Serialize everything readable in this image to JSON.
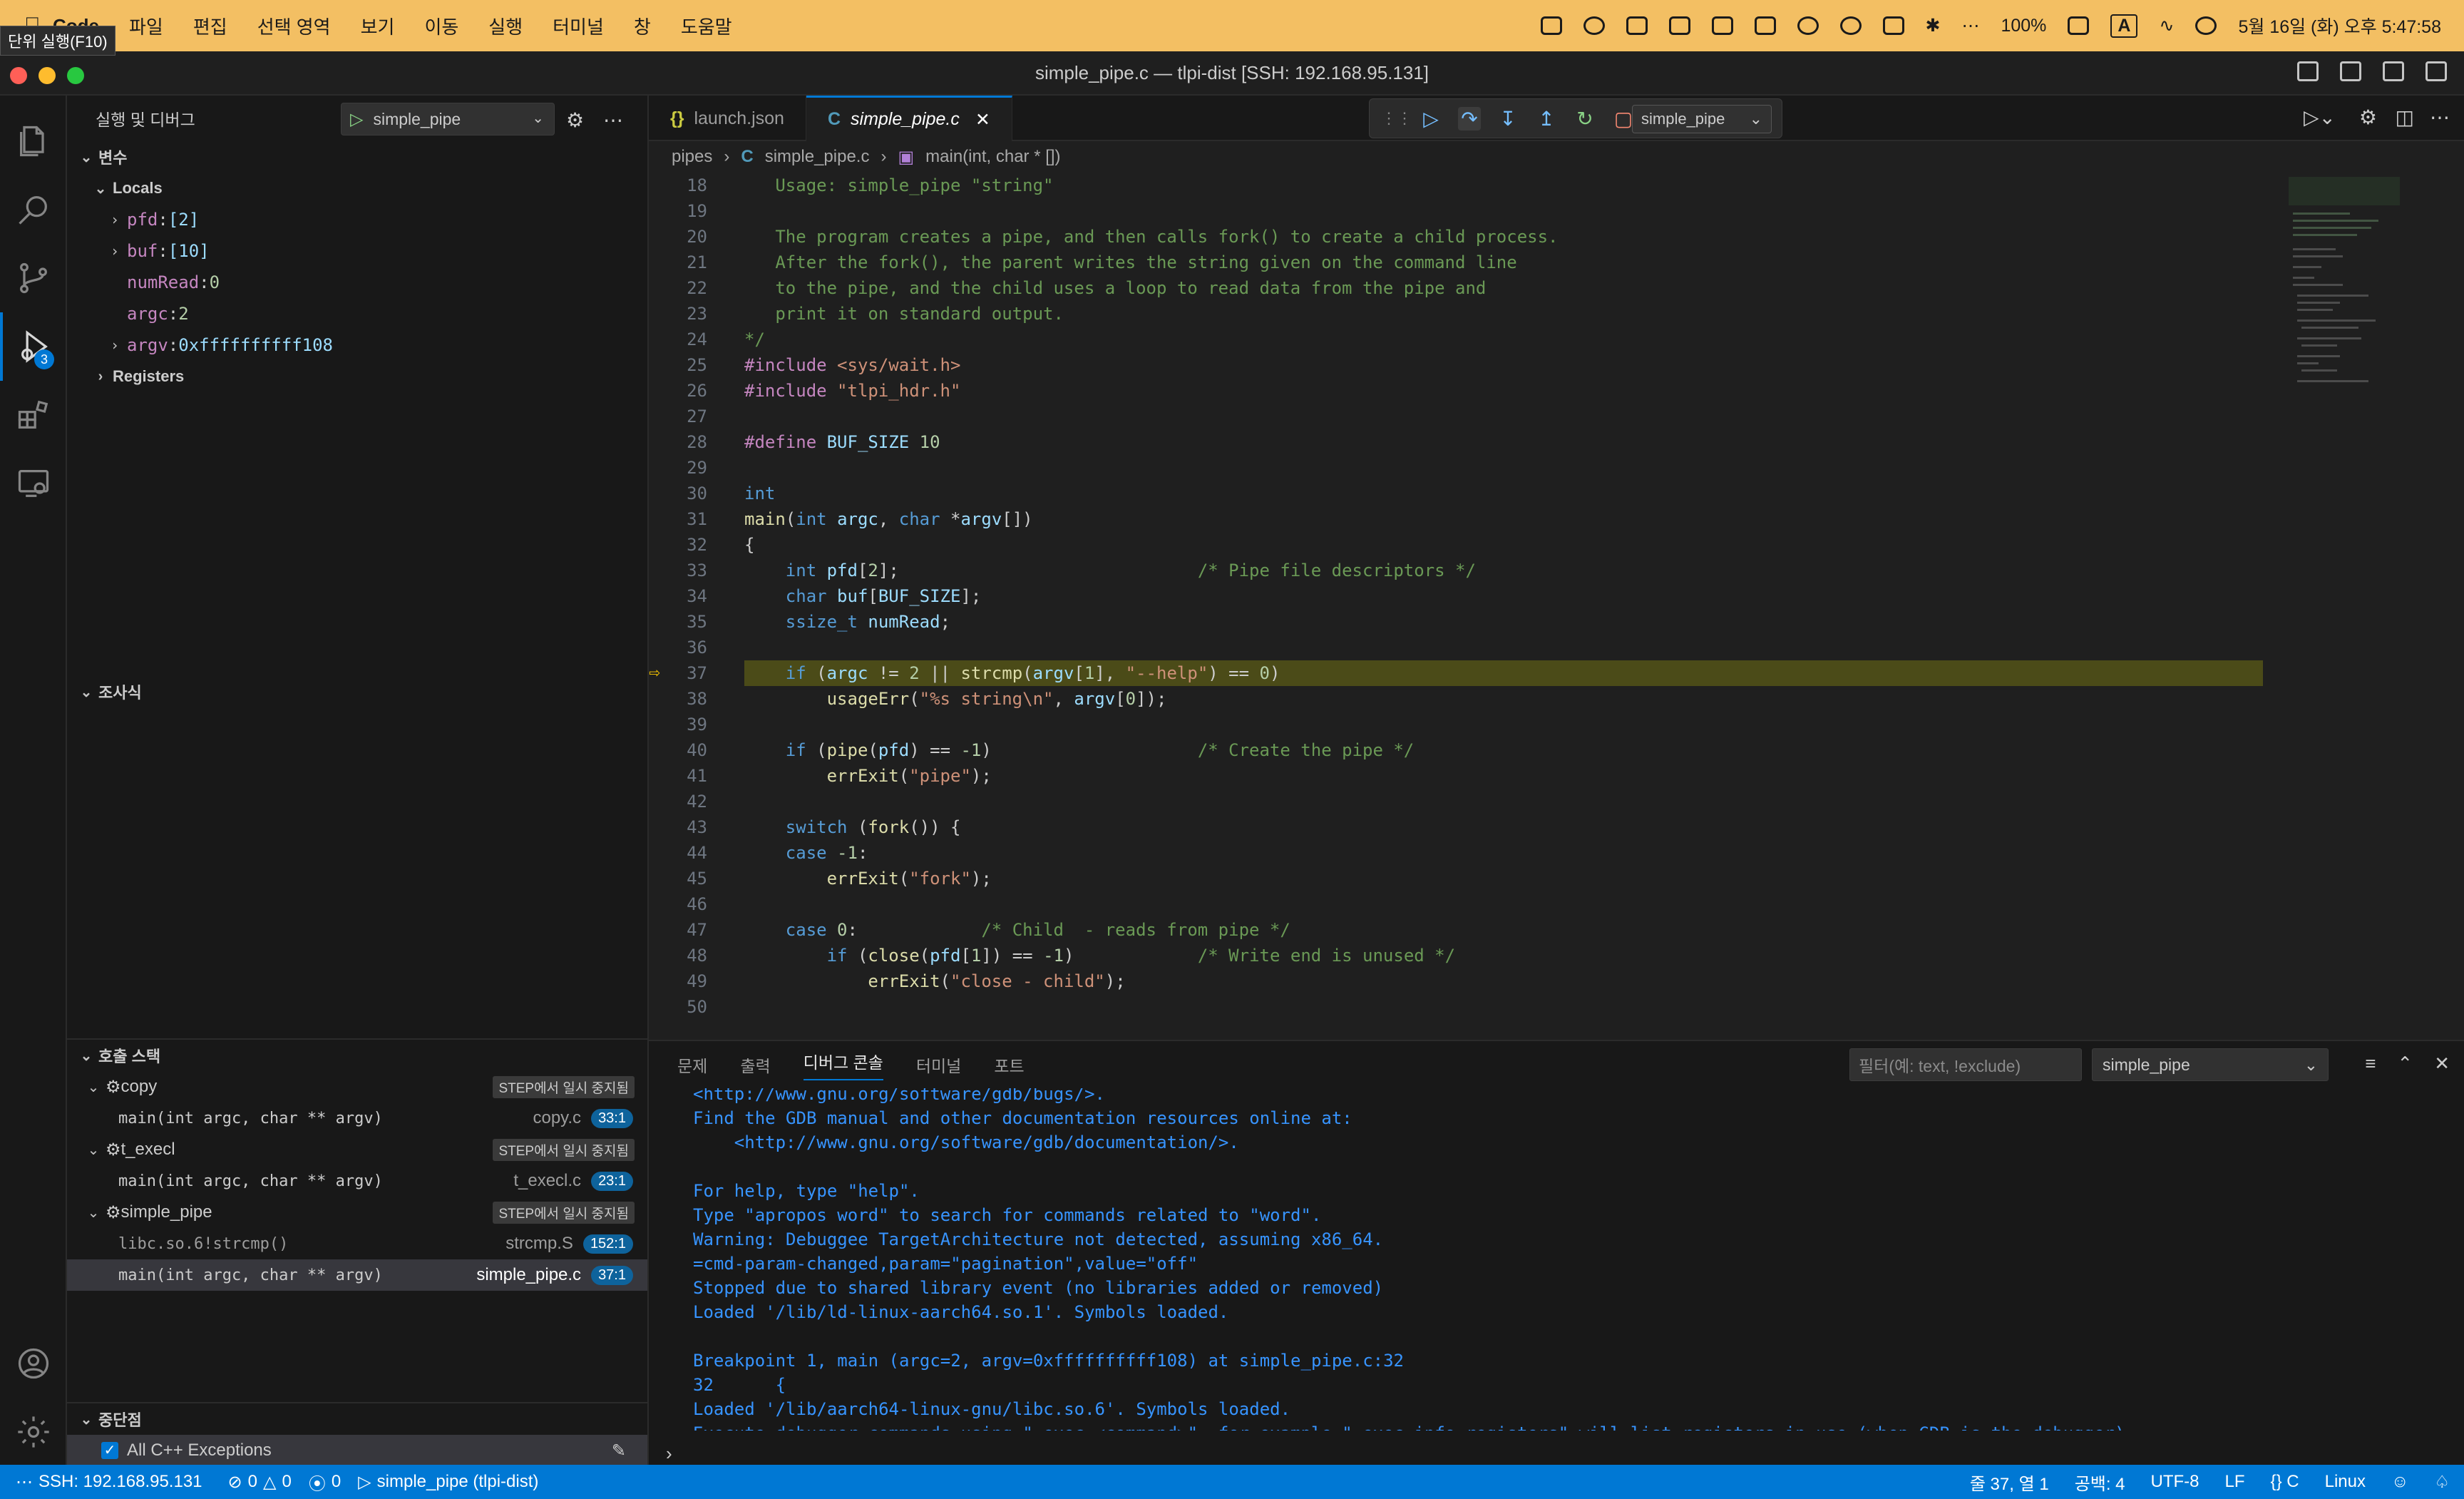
{
  "menubar": {
    "app_name": "Code",
    "items": [
      "파일",
      "편집",
      "선택 영역",
      "보기",
      "이동",
      "실행",
      "터미널",
      "창",
      "도움말"
    ],
    "battery": "100%",
    "input_indicator": "A",
    "datetime": "5월 16일 (화) 오후 5:47:58"
  },
  "tooltip": "단위 실행(F10)",
  "window": {
    "title": "simple_pipe.c — tlpi-dist [SSH: 192.168.95.131]"
  },
  "activity": {
    "debug_badge": "3"
  },
  "sidebar": {
    "title": "실행 및 디버그",
    "config_name": "simple_pipe",
    "variables_title": "변수",
    "locals_title": "Locals",
    "locals": [
      {
        "name": "pfd",
        "value": "[2]",
        "expandable": true
      },
      {
        "name": "buf",
        "value": "[10]",
        "expandable": true
      },
      {
        "name": "numRead",
        "value": "0",
        "expandable": false
      },
      {
        "name": "argc",
        "value": "2",
        "expandable": false
      },
      {
        "name": "argv",
        "value": "0xffffffffff108",
        "expandable": true
      }
    ],
    "registers_title": "Registers",
    "watch_title": "조사식",
    "callstack_title": "호출 스택",
    "callstack": [
      {
        "thread": "copy",
        "status": "STEP에서 일시 중지됨",
        "frames": [
          {
            "func": "main(int argc, char ** argv)",
            "file": "copy.c",
            "line": "33:1"
          }
        ]
      },
      {
        "thread": "t_execl",
        "status": "STEP에서 일시 중지됨",
        "frames": [
          {
            "func": "main(int argc, char ** argv)",
            "file": "t_execl.c",
            "line": "23:1"
          }
        ]
      },
      {
        "thread": "simple_pipe",
        "status": "STEP에서 일시 중지됨",
        "frames": [
          {
            "func": "libc.so.6!strcmp()",
            "file": "strcmp.S",
            "line": "152:1"
          },
          {
            "func": "main(int argc, char ** argv)",
            "file": "simple_pipe.c",
            "line": "37:1"
          }
        ]
      }
    ],
    "breakpoints_title": "중단점",
    "breakpoint_item": "All C++ Exceptions"
  },
  "editor": {
    "tabs": [
      {
        "label": "launch.json"
      },
      {
        "label": "simple_pipe.c"
      }
    ],
    "debug_config": "simple_pipe",
    "breadcrumb": [
      "pipes",
      "simple_pipe.c",
      "main(int, char * [])"
    ],
    "lines": [
      {
        "n": "18",
        "t": "   Usage: simple_pipe \"string\""
      },
      {
        "n": "19",
        "t": ""
      },
      {
        "n": "20",
        "t": "   The program creates a pipe, and then calls fork() to create a child process."
      },
      {
        "n": "21",
        "t": "   After the fork(), the parent writes the string given on the command line"
      },
      {
        "n": "22",
        "t": "   to the pipe, and the child uses a loop to read data from the pipe and"
      },
      {
        "n": "23",
        "t": "   print it on standard output."
      },
      {
        "n": "24",
        "t": "*/"
      },
      {
        "n": "25",
        "t": "#include <sys/wait.h>"
      },
      {
        "n": "26",
        "t": "#include \"tlpi_hdr.h\""
      },
      {
        "n": "27",
        "t": ""
      },
      {
        "n": "28",
        "t": "#define BUF_SIZE 10"
      },
      {
        "n": "29",
        "t": ""
      },
      {
        "n": "30",
        "t": "int"
      },
      {
        "n": "31",
        "t": "main(int argc, char *argv[])"
      },
      {
        "n": "32",
        "t": "{"
      },
      {
        "n": "33",
        "t": "    int pfd[2];                             /* Pipe file descriptors */"
      },
      {
        "n": "34",
        "t": "    char buf[BUF_SIZE];"
      },
      {
        "n": "35",
        "t": "    ssize_t numRead;"
      },
      {
        "n": "36",
        "t": ""
      },
      {
        "n": "37",
        "t": "    if (argc != 2 || strcmp(argv[1], \"--help\") == 0)"
      },
      {
        "n": "38",
        "t": "        usageErr(\"%s string\\n\", argv[0]);"
      },
      {
        "n": "39",
        "t": ""
      },
      {
        "n": "40",
        "t": "    if (pipe(pfd) == -1)                    /* Create the pipe */"
      },
      {
        "n": "41",
        "t": "        errExit(\"pipe\");"
      },
      {
        "n": "42",
        "t": ""
      },
      {
        "n": "43",
        "t": "    switch (fork()) {"
      },
      {
        "n": "44",
        "t": "    case -1:"
      },
      {
        "n": "45",
        "t": "        errExit(\"fork\");"
      },
      {
        "n": "46",
        "t": ""
      },
      {
        "n": "47",
        "t": "    case 0:            /* Child  - reads from pipe */"
      },
      {
        "n": "48",
        "t": "        if (close(pfd[1]) == -1)            /* Write end is unused */"
      },
      {
        "n": "49",
        "t": "            errExit(\"close - child\");"
      },
      {
        "n": "50",
        "t": ""
      }
    ]
  },
  "panel": {
    "tabs": [
      "문제",
      "출력",
      "디버그 콘솔",
      "터미널",
      "포트"
    ],
    "filter_placeholder": "필터(예: text, !exclude)",
    "select_value": "simple_pipe",
    "console": [
      "<http://www.gnu.org/software/gdb/bugs/>.",
      "Find the GDB manual and other documentation resources online at:",
      "    <http://www.gnu.org/software/gdb/documentation/>.",
      "",
      "For help, type \"help\".",
      "Type \"apropos word\" to search for commands related to \"word\".",
      "Warning: Debuggee TargetArchitecture not detected, assuming x86_64.",
      "=cmd-param-changed,param=\"pagination\",value=\"off\"",
      "Stopped due to shared library event (no libraries added or removed)",
      "Loaded '/lib/ld-linux-aarch64.so.1'. Symbols loaded.",
      "",
      "Breakpoint 1, main (argc=2, argv=0xffffffffff108) at simple_pipe.c:32",
      "32      {",
      "Loaded '/lib/aarch64-linux-gnu/libc.so.6'. Symbols loaded.",
      "Execute debugger commands using \"-exec <command>\", for example \"-exec info registers\" will list registers in use (when GDB is the debugger)"
    ]
  },
  "statusbar": {
    "remote": "SSH: 192.168.95.131",
    "errors": "0",
    "warnings": "0",
    "ports": "0",
    "debug_target": "simple_pipe (tlpi-dist)",
    "position": "줄 37, 열 1",
    "spaces": "공백: 4",
    "encoding": "UTF-8",
    "eol": "LF",
    "language": "C",
    "platform": "Linux"
  },
  "colors": {
    "menubar_bg": "#f3bf63",
    "accent": "#0078d4",
    "current_line": "#4b4b18"
  }
}
